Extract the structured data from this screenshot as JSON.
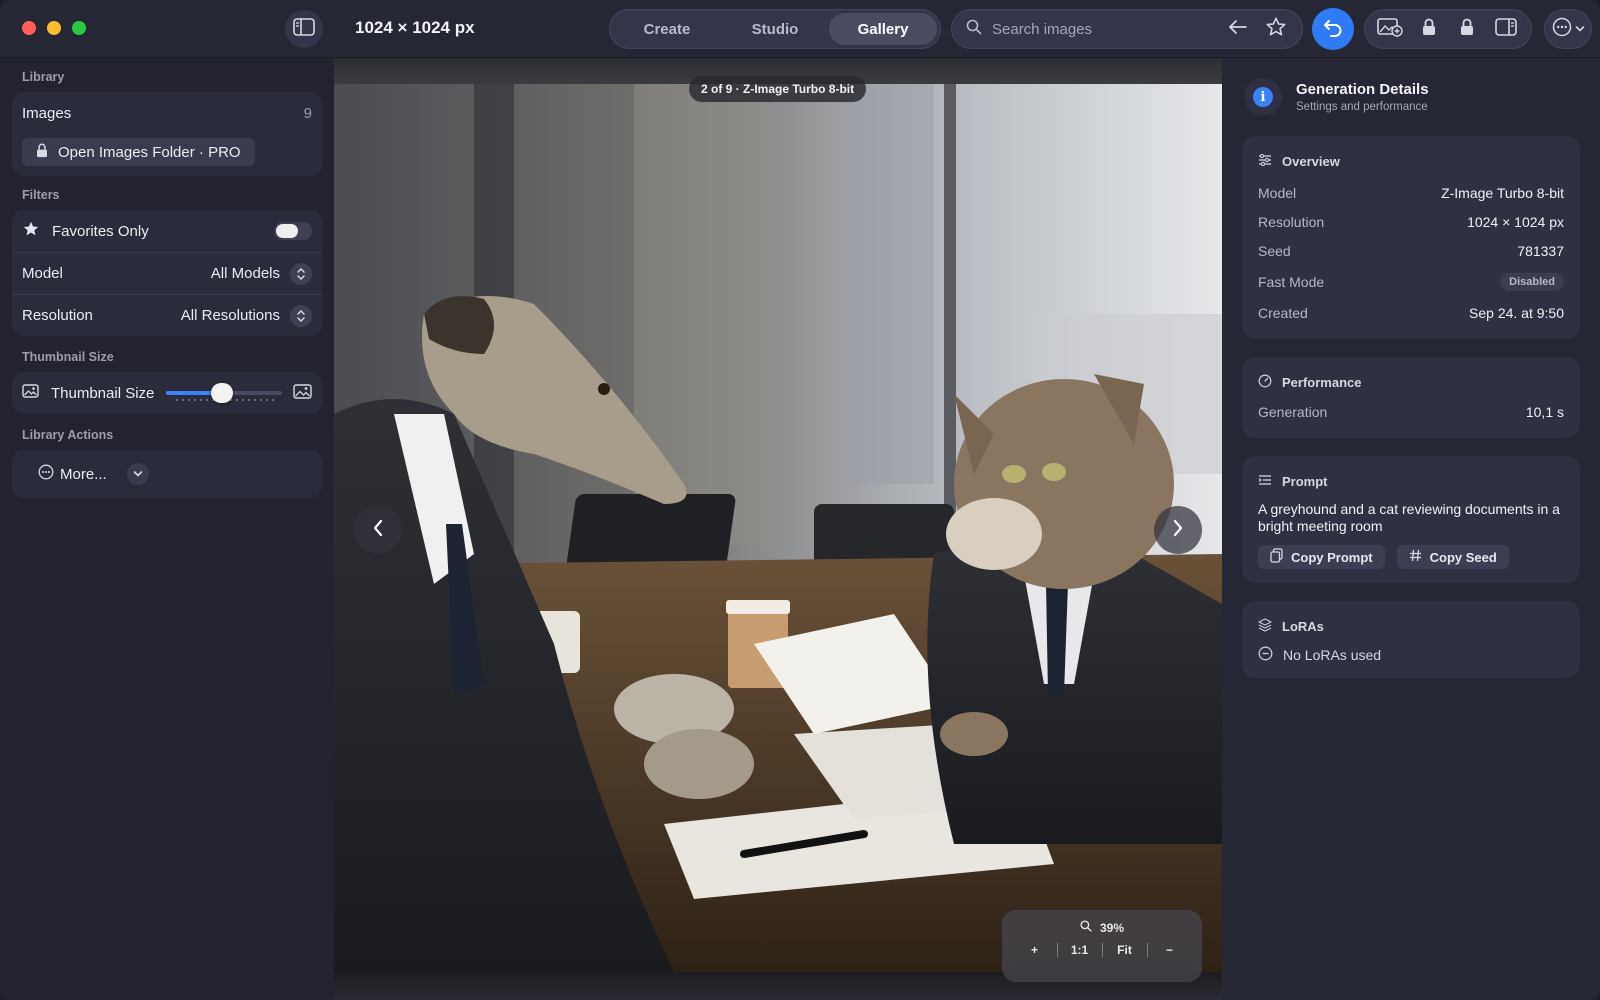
{
  "window": {
    "title": "1024 × 1024 px"
  },
  "toolbar": {
    "tabs": [
      {
        "label": "Create",
        "active": false
      },
      {
        "label": "Studio",
        "active": false
      },
      {
        "label": "Gallery",
        "active": true
      }
    ],
    "search": {
      "placeholder": "Search images",
      "value": ""
    }
  },
  "sidebar": {
    "library_label": "Library",
    "images_label": "Images",
    "images_count": "9",
    "open_folder_label": "Open Images Folder · PRO",
    "filters_label": "Filters",
    "favorites_label": "Favorites Only",
    "model_label": "Model",
    "model_value": "All Models",
    "resolution_label": "Resolution",
    "resolution_value": "All Resolutions",
    "thumbnail_section_label": "Thumbnail Size",
    "thumbnail_label": "Thumbnail Size",
    "thumbnail_level": 0.47,
    "actions_label": "Library Actions",
    "more_label": "More..."
  },
  "viewer": {
    "counter": "2 of 9 · Z-Image Turbo 8-bit",
    "zoom_percent": "39%",
    "zoom_in": "+",
    "zoom_actual": "1:1",
    "zoom_fit": "Fit",
    "zoom_out": "−"
  },
  "details": {
    "title": "Generation Details",
    "subtitle": "Settings and performance",
    "overview": {
      "title": "Overview",
      "rows": [
        {
          "key": "Model",
          "value": "Z-Image Turbo 8-bit"
        },
        {
          "key": "Resolution",
          "value": "1024 × 1024 px"
        },
        {
          "key": "Seed",
          "value": "781337"
        },
        {
          "key": "Fast Mode",
          "value": "Disabled"
        },
        {
          "key": "Created",
          "value": "Sep 24. at 9:50"
        }
      ]
    },
    "performance": {
      "title": "Performance",
      "generation_label": "Generation",
      "generation_value": "10,1 s"
    },
    "prompt": {
      "title": "Prompt",
      "text": "A greyhound and a cat reviewing documents in a bright meeting room",
      "copy_prompt_label": "Copy Prompt",
      "copy_seed_label": "Copy Seed"
    },
    "loras": {
      "title": "LoRAs",
      "empty_label": "No LoRAs used"
    }
  },
  "colors": {
    "accent": "#3b82f6",
    "background": "#22232f"
  }
}
